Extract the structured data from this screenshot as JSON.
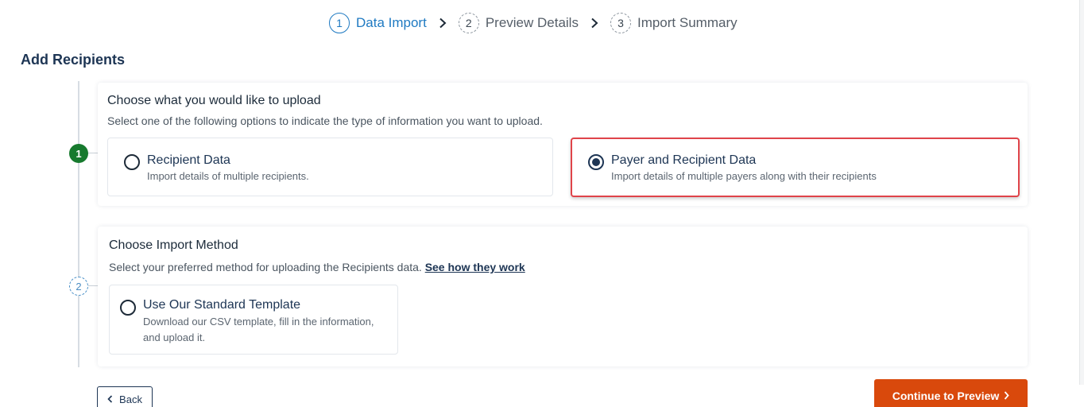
{
  "stepper": {
    "steps": [
      {
        "num": "1",
        "label": "Data Import"
      },
      {
        "num": "2",
        "label": "Preview Details"
      },
      {
        "num": "3",
        "label": "Import Summary"
      }
    ]
  },
  "page": {
    "title": "Add Recipients"
  },
  "timeline": {
    "markers": [
      "1",
      "2"
    ]
  },
  "upload_card": {
    "heading": "Choose what you would like to upload",
    "subtitle": "Select one of the following options to indicate the type of information you want to upload.",
    "options": [
      {
        "title": "Recipient Data",
        "desc": "Import details of multiple recipients.",
        "selected": false
      },
      {
        "title": "Payer and Recipient Data",
        "desc": "Import details of multiple payers along with their recipients",
        "selected": true
      }
    ]
  },
  "method_card": {
    "heading": "Choose Import Method",
    "subtitle": "Select your preferred method for uploading the Recipients data.",
    "link": "See how they work",
    "options": [
      {
        "title": "Use Our Standard Template",
        "desc_line1": "Download our CSV template, fill in the information,",
        "desc_line2": "and upload it.",
        "selected": false
      }
    ]
  },
  "footer": {
    "back_label": "Back",
    "continue_label": "Continue to Preview"
  },
  "colors": {
    "accent": "#1f7ac2",
    "primary_button": "#d9490c",
    "done_marker": "#177a2e",
    "highlight": "#e0444a",
    "navy": "#1d3554"
  }
}
